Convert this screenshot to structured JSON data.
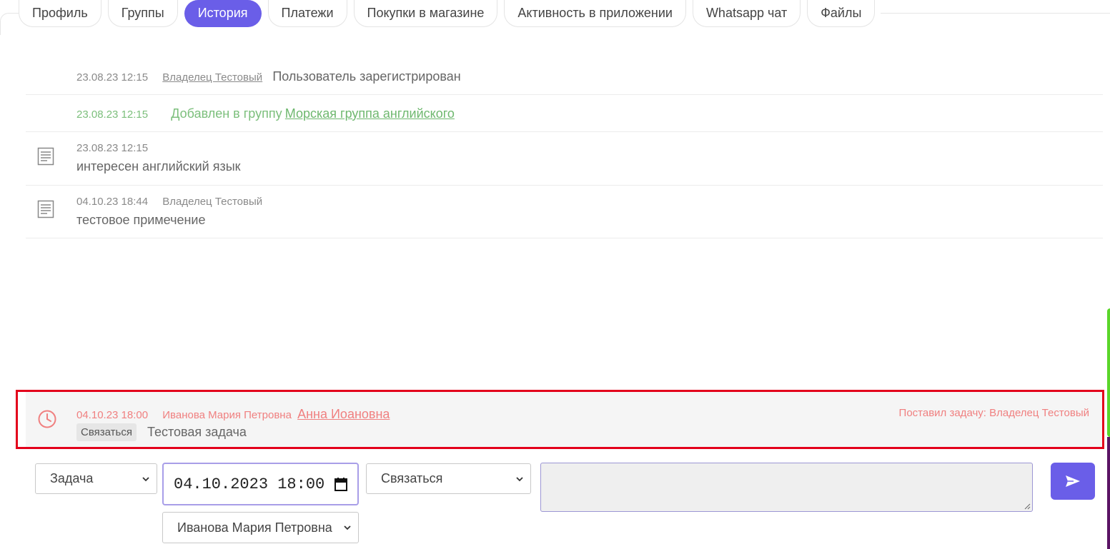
{
  "tabs": [
    {
      "label": "Профиль"
    },
    {
      "label": "Группы"
    },
    {
      "label": "История",
      "active": true
    },
    {
      "label": "Платежи"
    },
    {
      "label": "Покупки в магазине"
    },
    {
      "label": "Активность в приложении"
    },
    {
      "label": "Whatsapp чат"
    },
    {
      "label": "Файлы"
    }
  ],
  "history": {
    "registration": {
      "time": "23.08.23 12:15",
      "author": "Владелец Тестовый",
      "text": "Пользователь зарегистрирован"
    },
    "group_add": {
      "time": "23.08.23 12:15",
      "text": "Добавлен в группу",
      "group": "Морская группа английского"
    },
    "note1": {
      "time": "23.08.23 12:15",
      "text": "интересен английский язык",
      "icon": "note-icon"
    },
    "note2": {
      "time": "04.10.23 18:44",
      "author": "Владелец Тестовый",
      "text": "тестовое примечение",
      "icon": "note-icon"
    }
  },
  "task": {
    "time": "04.10.23 18:00",
    "assignee": "Иванова Мария Петровна",
    "client": "Анна Иоановна",
    "creator": "Поставил задачу: Владелец Тестовый",
    "tag": "Связаться",
    "text": "Тестовая задача",
    "icon": "clock-icon",
    "color": "#f08080"
  },
  "form": {
    "type_value": "Задача",
    "datetime_value": "04.10.2023 18:00",
    "action_value": "Связаться",
    "assignee_value": "Иванова Мария Петровна",
    "message_value": "",
    "send_icon": "send-icon"
  },
  "colors": {
    "accent": "#6a5ee8",
    "highlight_frame": "#e3001b",
    "green": "#7cbf7c"
  }
}
